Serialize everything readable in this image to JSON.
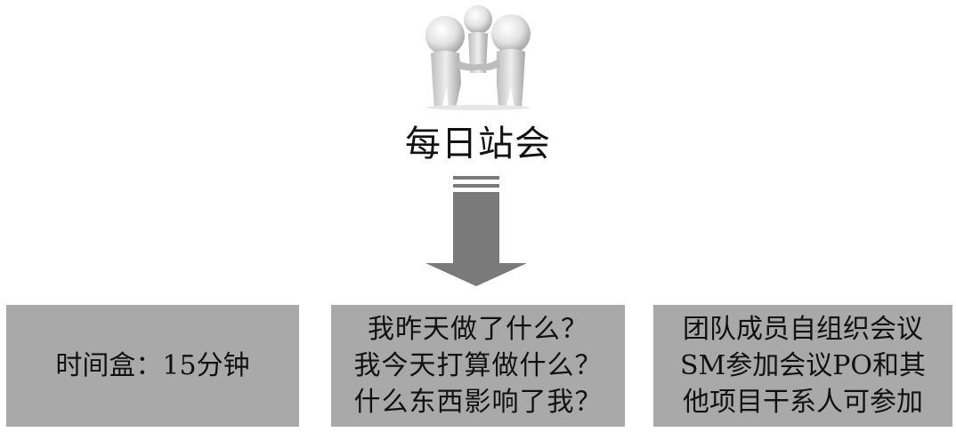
{
  "title": "每日站会",
  "boxes": [
    {
      "lines": [
        "时间盒：15分钟"
      ]
    },
    {
      "lines": [
        "我昨天做了什么？",
        "我今天打算做什么？",
        "什么东西影响了我？"
      ]
    },
    {
      "lines": [
        "团队成员自组织会议",
        "SM参加会议PO和其",
        "他项目干系人可参加"
      ]
    }
  ],
  "colors": {
    "box_fill": "#a9a9a9",
    "arrow_fill": "#7a7a7a",
    "figure_fill": "#d9d9d9"
  },
  "icons": [
    "team-people-icon",
    "down-arrow-icon"
  ]
}
